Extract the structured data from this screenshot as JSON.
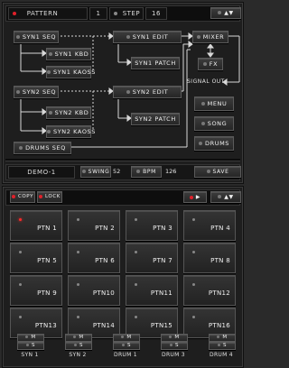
{
  "header": {
    "pattern_label": "PATTERN",
    "pattern_value": "1",
    "step_label": "STEP",
    "step_value": "16",
    "updown_glyph": "▲▼"
  },
  "routing": {
    "syn1_seq": "SYN1 SEQ",
    "syn1_kbd": "SYN1 KBD",
    "syn1_kaoss": "SYN1 KAOSS",
    "syn1_edit": "SYN1 EDIT",
    "syn1_patch": "SYN1 PATCH",
    "syn2_seq": "SYN2 SEQ",
    "syn2_kbd": "SYN2 KBD",
    "syn2_kaoss": "SYN2 KAOSS",
    "syn2_edit": "SYN2 EDIT",
    "syn2_patch": "SYN2 PATCH",
    "drums_seq": "DRUMS SEQ",
    "mixer": "MIXER",
    "fx": "FX",
    "signal_out": "SIGNAL OUT"
  },
  "side_menu": {
    "menu": "MENU",
    "song": "SONG",
    "drums": "DRUMS"
  },
  "footer": {
    "song_name": "DEMO-1",
    "swing_label": "SWING",
    "swing_value": "52",
    "bpm_label": "BPM",
    "bpm_value": "126",
    "save_label": "SAVE"
  },
  "pattern_bar": {
    "copy_label": "COPY",
    "lock_label": "LOCK",
    "play_glyph": "▶",
    "updown_glyph": "▲▼"
  },
  "patterns": [
    {
      "label": "PTN 1",
      "active": true
    },
    {
      "label": "PTN 2",
      "active": false
    },
    {
      "label": "PTN 3",
      "active": false
    },
    {
      "label": "PTN 4",
      "active": false
    },
    {
      "label": "PTN 5",
      "active": false
    },
    {
      "label": "PTN 6",
      "active": false
    },
    {
      "label": "PTN 7",
      "active": false
    },
    {
      "label": "PTN 8",
      "active": false
    },
    {
      "label": "PTN 9",
      "active": false
    },
    {
      "label": "PTN10",
      "active": false
    },
    {
      "label": "PTN11",
      "active": false
    },
    {
      "label": "PTN12",
      "active": false
    },
    {
      "label": "PTN13",
      "active": false
    },
    {
      "label": "PTN14",
      "active": false
    },
    {
      "label": "PTN15",
      "active": false
    },
    {
      "label": "PTN16",
      "active": false
    }
  ],
  "channels": [
    {
      "name": "SYN 1",
      "mute": "M",
      "solo": "S"
    },
    {
      "name": "SYN 2",
      "mute": "M",
      "solo": "S"
    },
    {
      "name": "DRUM 1",
      "mute": "M",
      "solo": "S"
    },
    {
      "name": "DRUM 3",
      "mute": "M",
      "solo": "S"
    },
    {
      "name": "DRUM 4",
      "mute": "M",
      "solo": "S"
    }
  ],
  "colors": {
    "led_red": "#e0202a",
    "panel": "#1e1e1e",
    "button_border": "#5a5a5a"
  }
}
